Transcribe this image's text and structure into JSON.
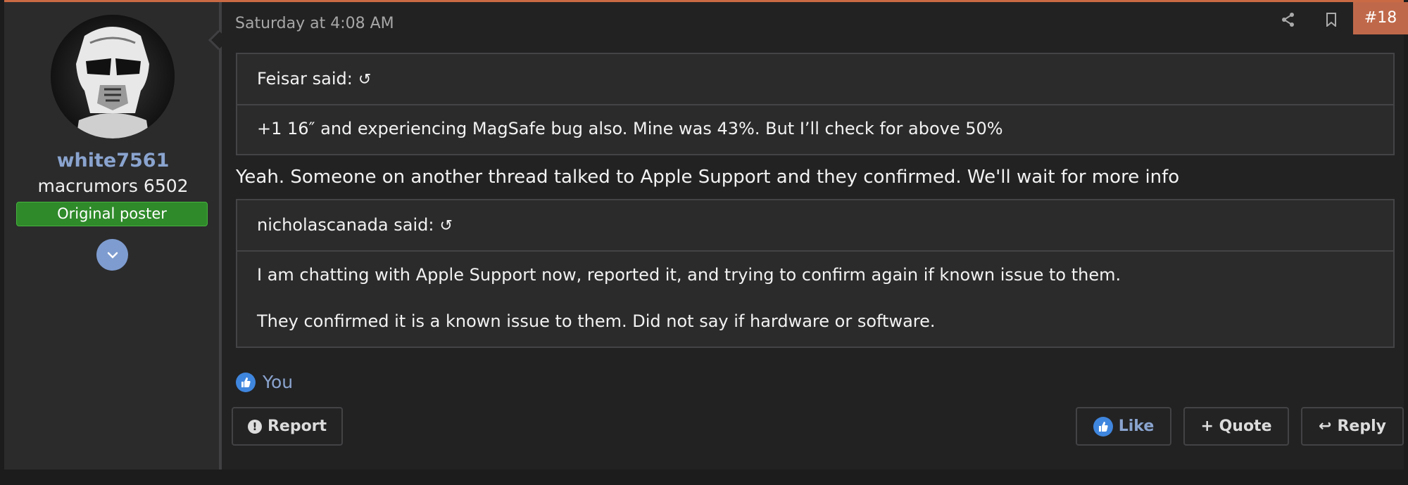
{
  "user": {
    "name": "white7561",
    "title": "macrumors 6502",
    "badge": "Original poster"
  },
  "post": {
    "date": "Saturday at 4:08 AM",
    "number": "#18",
    "quotes": [
      {
        "author": "Feisar said:",
        "back_icon": "↺",
        "lines": [
          "+1 16″ and experiencing MagSafe bug also. Mine was 43%. But I’ll check for above 50%"
        ]
      },
      {
        "author": "nicholascanada said:",
        "back_icon": "↺",
        "lines": [
          "I am chatting with Apple Support now, reported it, and trying to confirm again if known issue to them.",
          "They confirmed it is a known issue to them. Did not say if hardware or software."
        ]
      }
    ],
    "reply_text": "Yeah. Someone on another thread talked to Apple Support and they confirmed. We'll wait for more info"
  },
  "reactions": {
    "names": "You",
    "icon": "thumbs-up-icon"
  },
  "actions": {
    "report": "Report",
    "like": "Like",
    "quote": "+ Quote",
    "reply": "Reply",
    "reply_icon": "↩"
  },
  "colors": {
    "accent": "#c96a44",
    "link": "#8aa4cf",
    "badge_green": "#2f8a2a",
    "like_blue": "#3f86de"
  }
}
